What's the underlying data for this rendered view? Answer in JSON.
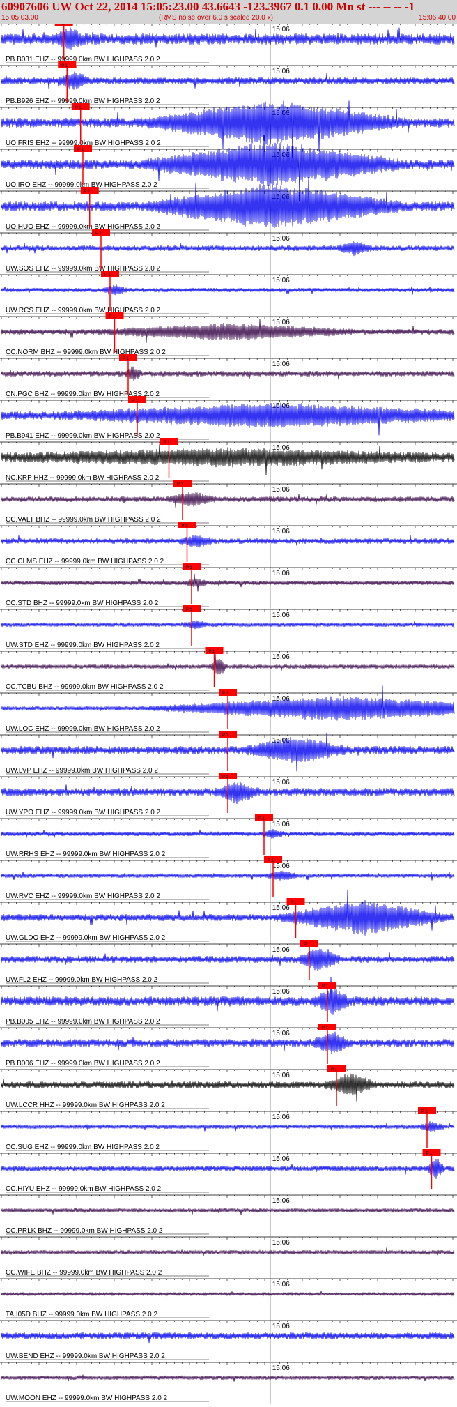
{
  "header": {
    "title": "60907606 UW Oct 22, 2014 15:05:23.00   43.6643 -123.3967  0.1 0.00 Mn st --- -- --  -1",
    "start_time": "15:05:03.00",
    "rms_note": "(RMS noise over 6.0 s scaled 20.0 x)",
    "end_time": "15:06:40.00"
  },
  "time_mark_label": "15:06",
  "pick_label": "P 1",
  "colors": {
    "header_bg": "#d4d4d4",
    "header_text": "#cc0000",
    "trace_blue": "#0000ee",
    "trace_dark": "#330044",
    "trace_black": "#000000",
    "pick": "#ff0000"
  },
  "traces": [
    {
      "label": "PB.B031 EHZ -- 99999.0km BW  HIGHPASS  2.0  2",
      "color": "blue",
      "amp": 8,
      "pick": 0.138,
      "event": {
        "pos": 0.15,
        "amp": 10,
        "dur": 0.04
      }
    },
    {
      "label": "PB.B926 EHZ -- 99999.0km BW  HIGHPASS  2.0  2",
      "color": "blue",
      "amp": 5,
      "pick": 0.145,
      "event": {
        "pos": 0.16,
        "amp": 10,
        "dur": 0.04
      }
    },
    {
      "label": "UO.FRIS EHZ -- 99999.0km BW  HIGHPASS  2.0  2",
      "color": "blue",
      "amp": 7,
      "pick": 0.175,
      "event": {
        "pos": 0.6,
        "amp": 28,
        "dur": 0.3
      }
    },
    {
      "label": "UO.IRO EHZ -- 99999.0km BW  HIGHPASS  2.0  2",
      "color": "blue",
      "amp": 7,
      "pick": 0.18,
      "event": {
        "pos": 0.6,
        "amp": 28,
        "dur": 0.3
      }
    },
    {
      "label": "UO.HUO EHZ -- 99999.0km BW  HIGHPASS  2.0  2",
      "color": "blue",
      "amp": 7,
      "pick": 0.195,
      "event": {
        "pos": 0.6,
        "amp": 28,
        "dur": 0.3
      }
    },
    {
      "label": "UW.SOS EHZ -- 99999.0km BW  HIGHPASS  2.0  2",
      "color": "blue",
      "amp": 4,
      "pick": 0.22,
      "event": {
        "pos": 0.78,
        "amp": 8,
        "dur": 0.04
      }
    },
    {
      "label": "UW.RCS EHZ -- 99999.0km BW  HIGHPASS  2.0  2",
      "color": "blue",
      "amp": 3,
      "pick": 0.24,
      "event": {
        "pos": 0.25,
        "amp": 6,
        "dur": 0.03
      }
    },
    {
      "label": "CC.NORM BHZ -- 99999.0km BW  HIGHPASS  2.0  2",
      "color": "dark",
      "amp": 4,
      "pick": 0.25,
      "event": {
        "pos": 0.5,
        "amp": 10,
        "dur": 0.3
      }
    },
    {
      "label": "CN.PGC BHZ -- 99999.0km BW  HIGHPASS  2.0  2",
      "color": "dark",
      "amp": 4,
      "pick": 0.28,
      "event": {
        "pos": 0.29,
        "amp": 8,
        "dur": 0.02
      }
    },
    {
      "label": "PB.B941 EHZ -- 99999.0km BW  HIGHPASS  2.0  2",
      "color": "blue",
      "amp": 6,
      "pick": 0.3,
      "event": {
        "pos": 0.6,
        "amp": 14,
        "dur": 0.5
      }
    },
    {
      "label": "NC.KRP HHZ -- 99999.0km BW  HIGHPASS  2.0  2",
      "color": "black",
      "amp": 7,
      "pick": 0.37,
      "event": {
        "pos": 0.5,
        "amp": 8,
        "dur": 0.5
      }
    },
    {
      "label": "CC.VALT BHZ -- 99999.0km BW  HIGHPASS  2.0  2",
      "color": "dark",
      "amp": 4,
      "pick": 0.4,
      "event": {
        "pos": 0.42,
        "amp": 8,
        "dur": 0.06
      }
    },
    {
      "label": "CC.CLMS EHZ -- 99999.0km BW  HIGHPASS  2.0  2",
      "color": "blue",
      "amp": 4,
      "pick": 0.41,
      "event": {
        "pos": 0.43,
        "amp": 7,
        "dur": 0.04
      }
    },
    {
      "label": "CC.STD BHZ -- 99999.0km BW  HIGHPASS  2.0  2",
      "color": "dark",
      "amp": 3,
      "pick": 0.42,
      "event": {
        "pos": 0.43,
        "amp": 5,
        "dur": 0.03
      }
    },
    {
      "label": "UW.STD EHZ -- 99999.0km BW  HIGHPASS  2.0  2",
      "color": "blue",
      "amp": 3,
      "pick": 0.42,
      "event": {
        "pos": 0.43,
        "amp": 5,
        "dur": 0.03
      }
    },
    {
      "label": "CC.TCBU BHZ -- 99999.0km BW  HIGHPASS  2.0  2",
      "color": "dark",
      "amp": 3,
      "pick": 0.47,
      "event": {
        "pos": 0.48,
        "amp": 12,
        "dur": 0.02
      }
    },
    {
      "label": "UW.LOC EHZ -- 99999.0km BW  HIGHPASS  2.0  2",
      "color": "blue",
      "amp": 3,
      "pick": 0.5,
      "event": {
        "pos": 0.75,
        "amp": 16,
        "dur": 0.45
      }
    },
    {
      "label": "UW.LVP EHZ -- 99999.0km BW  HIGHPASS  2.0  2",
      "color": "blue",
      "amp": 6,
      "pick": 0.5,
      "event": {
        "pos": 0.65,
        "amp": 16,
        "dur": 0.12
      }
    },
    {
      "label": "UW.YPO EHZ -- 99999.0km BW  HIGHPASS  2.0  2",
      "color": "blue",
      "amp": 6,
      "pick": 0.5,
      "event": {
        "pos": 0.52,
        "amp": 12,
        "dur": 0.05
      }
    },
    {
      "label": "UW.RRHS EHZ -- 99999.0km BW  HIGHPASS  2.0  2",
      "color": "blue",
      "amp": 3,
      "pick": 0.58,
      "event": {
        "pos": 0.6,
        "amp": 5,
        "dur": 0.03
      }
    },
    {
      "label": "UW.RVC EHZ -- 99999.0km BW  HIGHPASS  2.0  2",
      "color": "blue",
      "amp": 3,
      "pick": 0.6,
      "event": {
        "pos": 0.62,
        "amp": 6,
        "dur": 0.04
      }
    },
    {
      "label": "UW.GLDO EHZ -- 99999.0km BW  HIGHPASS  2.0  2",
      "color": "blue",
      "amp": 5,
      "pick": 0.65,
      "event": {
        "pos": 0.8,
        "amp": 22,
        "dur": 0.2
      }
    },
    {
      "label": "UW.FL2 EHZ -- 99999.0km BW  HIGHPASS  2.0  2",
      "color": "blue",
      "amp": 5,
      "pick": 0.68,
      "event": {
        "pos": 0.7,
        "amp": 14,
        "dur": 0.05
      }
    },
    {
      "label": "PB.B005 EHZ -- 99999.0km BW  HIGHPASS  2.0  2",
      "color": "blue",
      "amp": 7,
      "pick": 0.72,
      "event": {
        "pos": 0.73,
        "amp": 16,
        "dur": 0.04
      }
    },
    {
      "label": "PB.B006 EHZ -- 99999.0km BW  HIGHPASS  2.0  2",
      "color": "blue",
      "amp": 6,
      "pick": 0.72,
      "event": {
        "pos": 0.73,
        "amp": 14,
        "dur": 0.04
      }
    },
    {
      "label": "UW.LCCR HHZ -- 99999.0km BW  HIGHPASS  2.0  2",
      "color": "black",
      "amp": 5,
      "pick": 0.74,
      "event": {
        "pos": 0.77,
        "amp": 14,
        "dur": 0.06
      }
    },
    {
      "label": "CC.SUG EHZ -- 99999.0km BW  HIGHPASS  2.0  2",
      "color": "blue",
      "amp": 3,
      "pick": 0.94,
      "event": {
        "pos": 0.95,
        "amp": 6,
        "dur": 0.03
      }
    },
    {
      "label": "CC.HIYU EHZ -- 99999.0km BW  HIGHPASS  2.0  2",
      "color": "blue",
      "amp": 4,
      "pick": 0.95,
      "event": {
        "pos": 0.96,
        "amp": 14,
        "dur": 0.02
      }
    },
    {
      "label": "CC.PRLK BHZ -- 99999.0km BW  HIGHPASS  2.0  2",
      "color": "dark",
      "amp": 3,
      "pick": null,
      "event": null
    },
    {
      "label": "CC.WIFE BHZ -- 99999.0km BW  HIGHPASS  2.0  2",
      "color": "dark",
      "amp": 3,
      "pick": null,
      "event": null
    },
    {
      "label": "TA.I05D BHZ -- 99999.0km BW  HIGHPASS  2.0  2",
      "color": "dark",
      "amp": 2,
      "pick": null,
      "event": null
    },
    {
      "label": "UW.BEND EHZ -- 99999.0km BW  HIGHPASS  2.0  2",
      "color": "blue",
      "amp": 5,
      "pick": null,
      "event": null
    },
    {
      "label": "UW.MOON EHZ -- 99999.0km BW  HIGHPASS  2.0  2",
      "color": "dark",
      "amp": 3,
      "pick": null,
      "event": null
    }
  ]
}
